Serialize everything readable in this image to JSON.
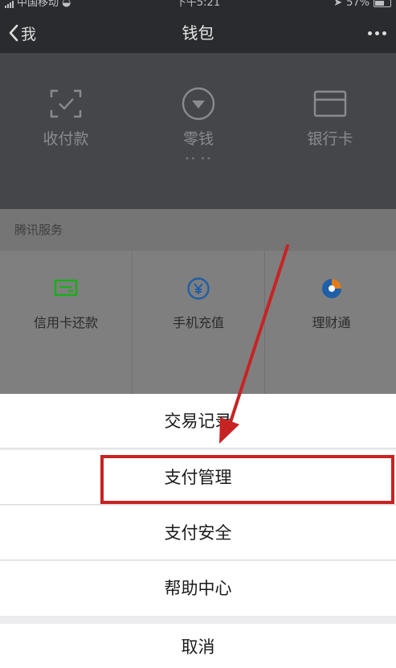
{
  "status_bar": {
    "carrier": "中国移动",
    "time": "下午5:21",
    "battery": "57%"
  },
  "nav": {
    "back_label": "我",
    "title": "钱包"
  },
  "wallet": {
    "items": [
      {
        "label": "收付款",
        "icon": "scan-icon"
      },
      {
        "label": "零钱",
        "icon": "coin-icon",
        "sub": "•• ••"
      },
      {
        "label": "银行卡",
        "icon": "card-icon"
      }
    ]
  },
  "services": {
    "header": "腾讯服务",
    "items": [
      {
        "label": "信用卡还款",
        "icon": "credit-card-icon",
        "color": "#1aad19"
      },
      {
        "label": "手机充值",
        "icon": "yen-icon",
        "color": "#1f5fa8"
      },
      {
        "label": "理财通",
        "icon": "wealth-icon",
        "color": "#1f5fa8"
      }
    ]
  },
  "action_sheet": {
    "items": [
      {
        "label": "交易记录"
      },
      {
        "label": "支付管理"
      },
      {
        "label": "支付安全"
      },
      {
        "label": "帮助中心"
      }
    ],
    "cancel_label": "取消"
  },
  "colors": {
    "highlight": "#c72323"
  }
}
